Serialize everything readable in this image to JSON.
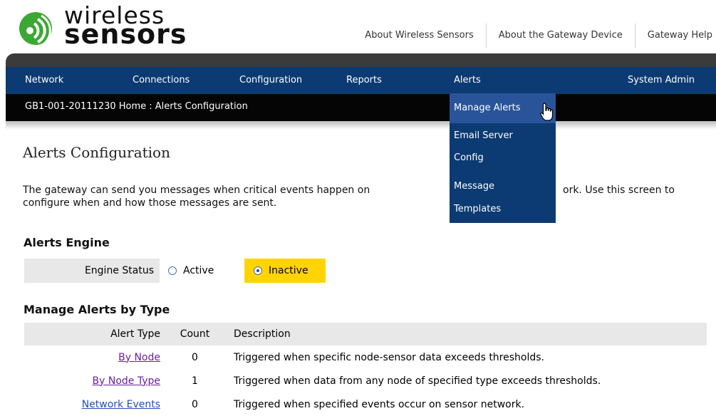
{
  "brand": {
    "line1": "wireless",
    "line2": "sensors"
  },
  "top_links": [
    "About Wireless Sensors",
    "About the Gateway Device",
    "Gateway Help"
  ],
  "nav": [
    "Network",
    "Connections",
    "Configuration",
    "Reports",
    "Alerts",
    "System Admin"
  ],
  "breadcrumb": "GB1-001-20111230 Home : Alerts Configuration",
  "dropdown": {
    "manage_alerts": "Manage Alerts",
    "email_server": "Email Server",
    "config": "Config",
    "message": "Message",
    "templates": "Templates"
  },
  "page_title": "Alerts Configuration",
  "intro": {
    "line1a": "The gateway can send you messages when critical events happen on",
    "line1b": "ork. Use this screen to",
    "line2": "configure when and how those messages are sent."
  },
  "engine": {
    "heading": "Alerts Engine",
    "label": "Engine Status",
    "active_label": "Active",
    "inactive_label": "Inactive",
    "selected": "Inactive"
  },
  "alerts_by_type": {
    "heading": "Manage Alerts by Type",
    "columns": [
      "Alert Type",
      "Count",
      "Description"
    ],
    "rows": [
      {
        "type": "By Node",
        "count": "0",
        "description": "Triggered when specific node-sensor data exceeds thresholds."
      },
      {
        "type": "By Node Type",
        "count": "1",
        "description": "Triggered when data from any node of specified type exceeds thresholds."
      },
      {
        "type": "Network Events",
        "count": "0",
        "description": "Triggered when specified events occur on sensor network."
      }
    ]
  },
  "colors": {
    "nav_bg": "#0c3a72",
    "highlight": "#ffd400",
    "visited_link": "#6a1fa0",
    "link": "#1f4fbf"
  }
}
